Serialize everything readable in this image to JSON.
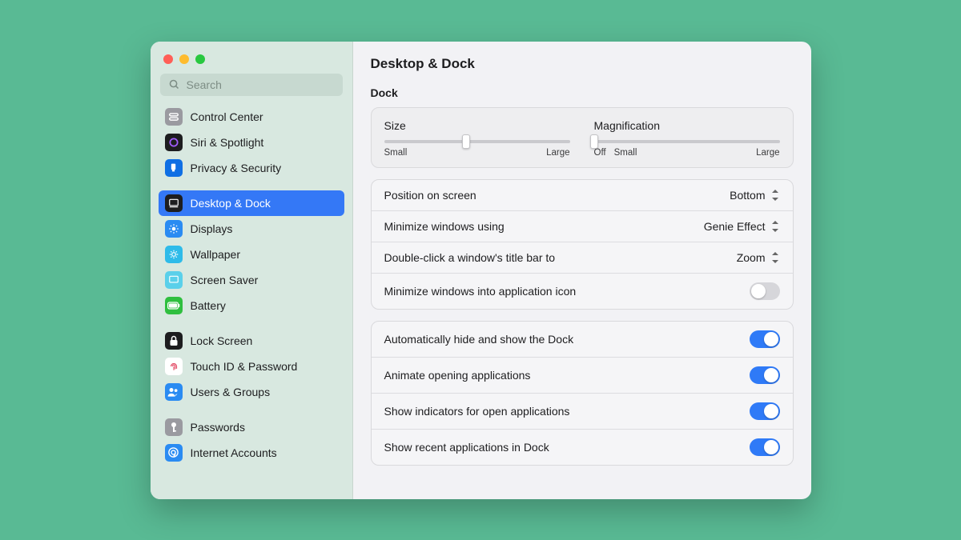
{
  "search": {
    "placeholder": "Search"
  },
  "sidebar": {
    "groups": [
      {
        "items": [
          {
            "id": "control-center",
            "label": "Control Center",
            "bg": "#9a9aa0"
          },
          {
            "id": "siri-spotlight",
            "label": "Siri & Spotlight",
            "bg": "#1d1d1f"
          },
          {
            "id": "privacy-security",
            "label": "Privacy & Security",
            "bg": "#0f6fe4"
          }
        ]
      },
      {
        "items": [
          {
            "id": "desktop-dock",
            "label": "Desktop & Dock",
            "bg": "#1d1d1f",
            "selected": true
          },
          {
            "id": "displays",
            "label": "Displays",
            "bg": "#2a8bf2"
          },
          {
            "id": "wallpaper",
            "label": "Wallpaper",
            "bg": "#2ebbe9"
          },
          {
            "id": "screen-saver",
            "label": "Screen Saver",
            "bg": "#5ad0ea"
          },
          {
            "id": "battery",
            "label": "Battery",
            "bg": "#2fbf3f"
          }
        ]
      },
      {
        "items": [
          {
            "id": "lock-screen",
            "label": "Lock Screen",
            "bg": "#1d1d1f"
          },
          {
            "id": "touch-id",
            "label": "Touch ID & Password",
            "bg": "#ffffff",
            "fg": "#e3506a"
          },
          {
            "id": "users-groups",
            "label": "Users & Groups",
            "bg": "#2a8bf2"
          }
        ]
      },
      {
        "items": [
          {
            "id": "passwords",
            "label": "Passwords",
            "bg": "#9a9aa0"
          },
          {
            "id": "internet-accounts",
            "label": "Internet Accounts",
            "bg": "#2a8bf2"
          }
        ]
      }
    ]
  },
  "page": {
    "title": "Desktop & Dock",
    "section_dock": "Dock",
    "sliders": {
      "size": {
        "label": "Size",
        "min_label": "Small",
        "max_label": "Large",
        "value_pct": 44
      },
      "mag": {
        "label": "Magnification",
        "off_label": "Off",
        "min_label": "Small",
        "max_label": "Large",
        "value_pct": 0
      }
    },
    "selects": {
      "position": {
        "label": "Position on screen",
        "value": "Bottom"
      },
      "minimize": {
        "label": "Minimize windows using",
        "value": "Genie Effect"
      },
      "doubleclick": {
        "label": "Double-click a window's title bar to",
        "value": "Zoom"
      }
    },
    "toggles": {
      "min_into_icon": {
        "label": "Minimize windows into application icon",
        "on": false
      },
      "auto_hide": {
        "label": "Automatically hide and show the Dock",
        "on": true
      },
      "animate": {
        "label": "Animate opening applications",
        "on": true
      },
      "indicators": {
        "label": "Show indicators for open applications",
        "on": true
      },
      "recents": {
        "label": "Show recent applications in Dock",
        "on": true
      }
    }
  }
}
